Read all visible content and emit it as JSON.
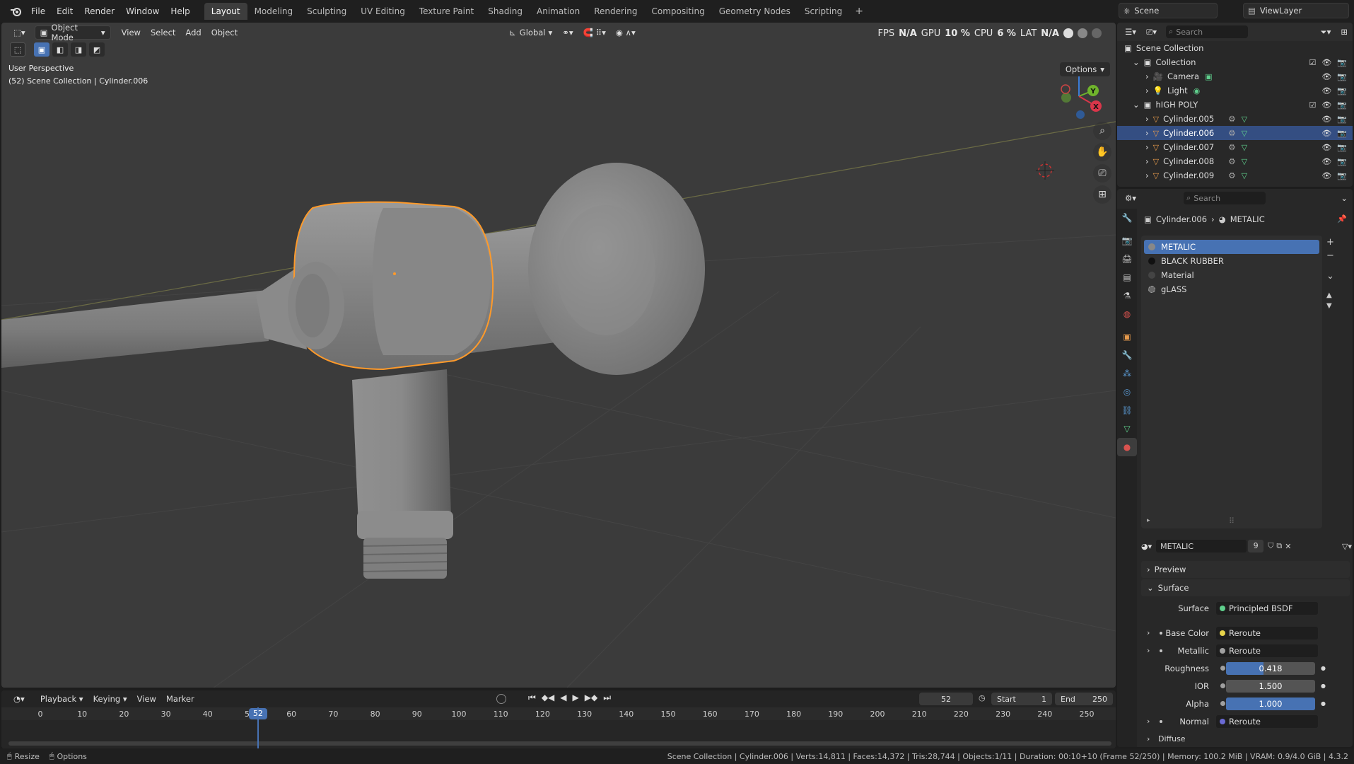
{
  "topbar": {
    "menus": [
      "File",
      "Edit",
      "Render",
      "Window",
      "Help"
    ],
    "workspaces": [
      "Layout",
      "Modeling",
      "Sculpting",
      "UV Editing",
      "Texture Paint",
      "Shading",
      "Animation",
      "Rendering",
      "Compositing",
      "Geometry Nodes",
      "Scripting"
    ],
    "active_workspace": "Layout",
    "scene": "Scene",
    "view_layer": "ViewLayer"
  },
  "viewport": {
    "mode": "Object Mode",
    "menus": [
      "View",
      "Select",
      "Add",
      "Object"
    ],
    "orientation": "Global",
    "info_line1": "User Perspective",
    "info_line2": "(52) Scene Collection | Cylinder.006",
    "overlay_stats": [
      "FPS",
      "N/A",
      "GPU",
      "10 %",
      "CPU",
      "6 %",
      "LAT",
      "N/A"
    ],
    "options_label": "Options",
    "gizmo": {
      "x": "X",
      "y": "Y",
      "z": "Z"
    }
  },
  "timeline": {
    "menus": [
      "Playback",
      "Keying",
      "View",
      "Marker"
    ],
    "current_frame": "52",
    "start_label": "Start",
    "start": "1",
    "end_label": "End",
    "end": "250",
    "ticks": [
      "0",
      "10",
      "20",
      "30",
      "40",
      "50",
      "60",
      "70",
      "80",
      "90",
      "100",
      "110",
      "120",
      "130",
      "140",
      "150",
      "160",
      "170",
      "180",
      "190",
      "200",
      "210",
      "220",
      "230",
      "240",
      "250"
    ]
  },
  "statusbar": {
    "left1": "Resize",
    "left2": "Options",
    "right": "Scene Collection | Cylinder.006 | Verts:14,811 | Faces:14,372 | Tris:28,744 | Objects:1/11 | Duration: 00:10+10 (Frame 52/250) | Memory: 100.2 MiB | VRAM: 0.9/4.0 GiB | 4.3.2"
  },
  "outliner": {
    "search_placeholder": "Search",
    "rows": [
      {
        "label": "Scene Collection"
      },
      {
        "label": "Collection"
      },
      {
        "label": "Camera"
      },
      {
        "label": "Light"
      },
      {
        "label": "hIGH POLY"
      },
      {
        "label": "Cylinder.005"
      },
      {
        "label": "Cylinder.006"
      },
      {
        "label": "Cylinder.007"
      },
      {
        "label": "Cylinder.008"
      },
      {
        "label": "Cylinder.009"
      }
    ]
  },
  "properties": {
    "search_placeholder": "Search",
    "breadcrumb_object": "Cylinder.006",
    "breadcrumb_material": "METALIC",
    "slots": [
      "METALIC",
      "BLACK RUBBER",
      "Material",
      "gLASS"
    ],
    "material_name": "METALIC",
    "user_count": "9",
    "panels": {
      "preview": "Preview",
      "surface": "Surface",
      "diffuse": "Diffuse"
    },
    "surface": {
      "label": "Surface",
      "value": "Principled BSDF"
    },
    "fields": {
      "base_color": {
        "label": "Base Color",
        "value": "Reroute"
      },
      "metallic": {
        "label": "Metallic",
        "value": "Reroute"
      },
      "roughness": {
        "label": "Roughness",
        "value": "0.418",
        "fraction": 0.418
      },
      "ior": {
        "label": "IOR",
        "value": "1.500",
        "fraction": 0
      },
      "alpha": {
        "label": "Alpha",
        "value": "1.000",
        "fraction": 1.0
      },
      "normal": {
        "label": "Normal",
        "value": "Reroute"
      }
    }
  },
  "colors": {
    "selection_outline": "#ff9a2a",
    "active_blue": "#4772b3",
    "outliner_selected": "#344e82",
    "mesh_icon": "#e69a4c"
  }
}
